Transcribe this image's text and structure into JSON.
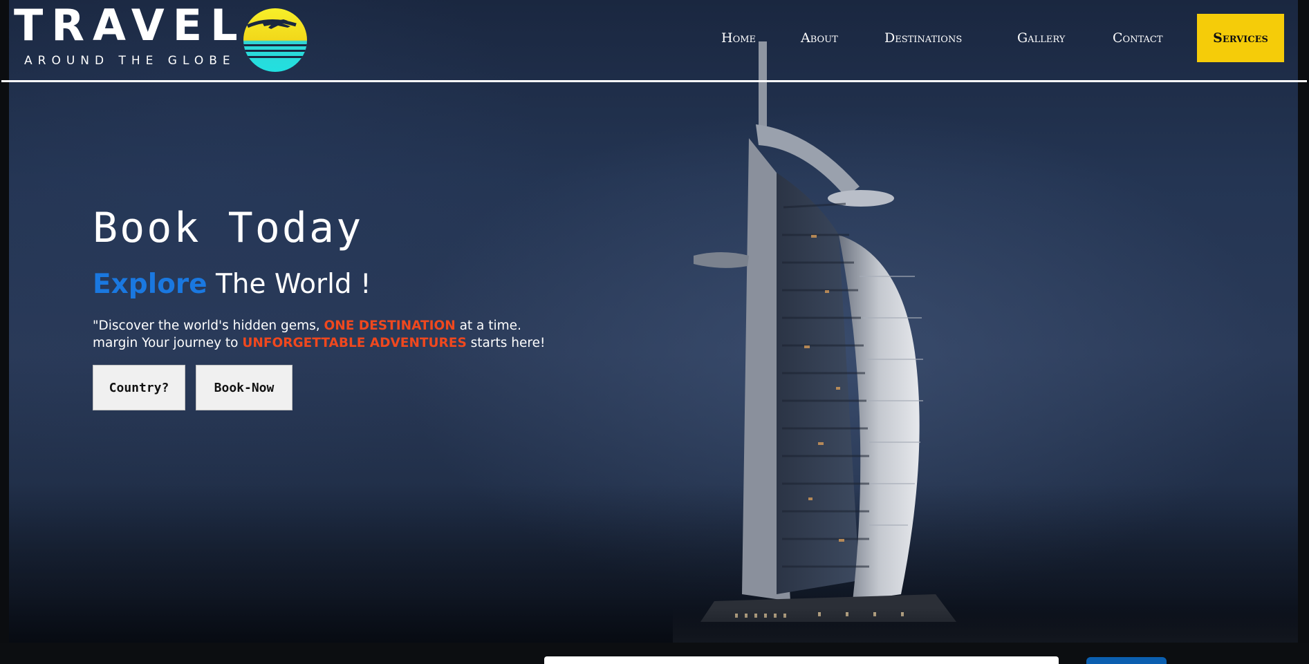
{
  "logo": {
    "word": "TRAVEL",
    "tagline": "AROUND THE GLOBE"
  },
  "nav": {
    "items": [
      {
        "label": "Home"
      },
      {
        "label": "About"
      },
      {
        "label": "Destinations"
      },
      {
        "label": "Gallery"
      },
      {
        "label": "Contact"
      }
    ],
    "cta": "Services"
  },
  "hero": {
    "title": "Book Today",
    "subtitle_accent": "Explore",
    "subtitle_rest": " The World !",
    "desc_part1": "\"Discover the world's hidden gems, ",
    "desc_hl1": "ONE DESTINATION",
    "desc_part2": " at a time.",
    "desc_part3": "margin Your journey to ",
    "desc_hl2": "UNFORGETTABLE ADVENTURES",
    "desc_part4": " starts here!",
    "buttons": {
      "country": "Country?",
      "book": "Book-Now"
    }
  },
  "colors": {
    "accent_blue": "#1a78e0",
    "highlight_orange": "#f0481e",
    "services_yellow": "#f5cc09",
    "globe_yellow": "#f5e21a",
    "globe_cyan": "#2ad9d9"
  },
  "icons": {
    "logo_mark": "globe-with-airplane-icon"
  }
}
